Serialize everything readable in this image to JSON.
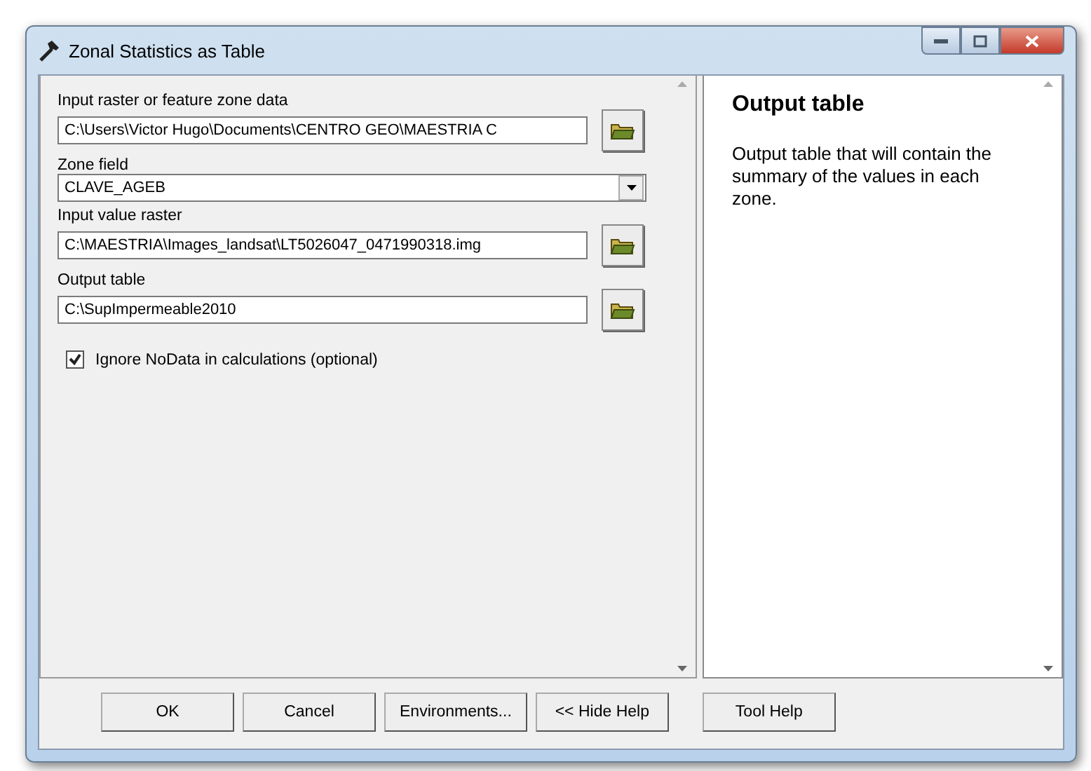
{
  "window": {
    "title": "Zonal Statistics as Table"
  },
  "parameters": [
    {
      "kind": "browse",
      "label": "Input raster or feature zone data",
      "value": "C:\\Users\\Victor Hugo\\Documents\\CENTRO GEO\\MAESTRIA C"
    },
    {
      "kind": "dropdown",
      "label": "Zone field",
      "value": "CLAVE_AGEB"
    },
    {
      "kind": "browse",
      "label": "Input value raster",
      "value": "C:\\MAESTRIA\\Images_landsat\\LT5026047_0471990318.img"
    },
    {
      "kind": "browse",
      "label": "Output table",
      "value": "C:\\SupImpermeable2010"
    },
    {
      "kind": "checkbox",
      "label": "Ignore NoData in calculations (optional)",
      "checked": true
    }
  ],
  "help": {
    "title": "Output table",
    "text": "Output table that will contain the summary of the values in each zone."
  },
  "buttons": [
    "OK",
    "Cancel",
    "Environments...",
    "<< Hide Help",
    "Tool Help"
  ]
}
